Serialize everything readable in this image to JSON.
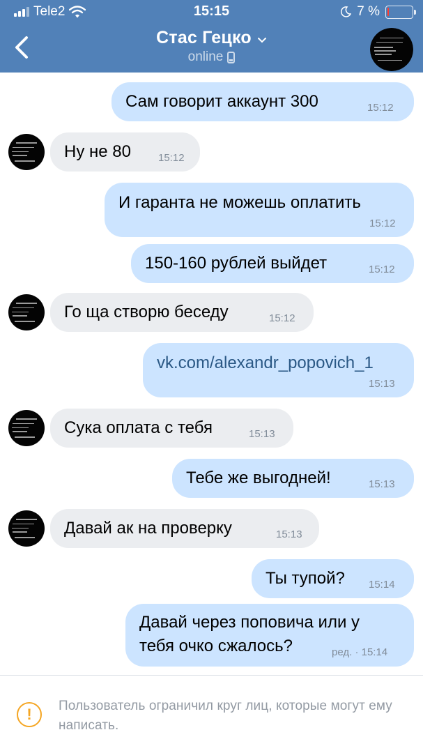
{
  "status_bar": {
    "carrier": "Tele2",
    "time": "15:15",
    "battery_pct": "7 %",
    "battery_level": 0.07
  },
  "header": {
    "contact_name": "Стас Гецко",
    "presence": "online"
  },
  "messages": [
    {
      "dir": "out",
      "text": "Сам говорит аккаунт 300",
      "time": "15:12"
    },
    {
      "dir": "in",
      "text": "Ну не 80",
      "time": "15:12"
    },
    {
      "dir": "out",
      "text": "И гаранта не можешь оплатить",
      "time": "15:12"
    },
    {
      "dir": "out",
      "text": "150-160 рублей выйдет",
      "time": "15:12"
    },
    {
      "dir": "in",
      "text": "Го ща створю беседу",
      "time": "15:12"
    },
    {
      "dir": "out",
      "text": "vk.com/alexandr_popovich_1",
      "time": "15:13"
    },
    {
      "dir": "in",
      "text": "Сука оплата с тебя",
      "time": "15:13"
    },
    {
      "dir": "out",
      "text": "Тебе же выгодней!",
      "time": "15:13"
    },
    {
      "dir": "in",
      "text": "Давай ак на проверку",
      "time": "15:13"
    },
    {
      "dir": "out",
      "text": "Ты тупой?",
      "time": "15:14"
    },
    {
      "dir": "out",
      "text_line1": "Давай через поповича или у",
      "text_line2": "тебя очко сжалось?",
      "time": "ред. · 15:14"
    }
  ],
  "footer": {
    "notice_text": "Пользователь ограничил круг лиц, которые могут ему написать."
  },
  "colors": {
    "header": "#5181b8",
    "bubble_out": "#cce4ff",
    "bubble_in": "#ebedf0",
    "link": "#2a5885",
    "warning": "#f5a623",
    "battery_low": "#ff3b30"
  },
  "icons": [
    "signal-icon",
    "wifi-icon",
    "moon-icon",
    "battery-icon",
    "back-icon",
    "chevron-down-icon",
    "phone-icon",
    "warning-icon"
  ]
}
